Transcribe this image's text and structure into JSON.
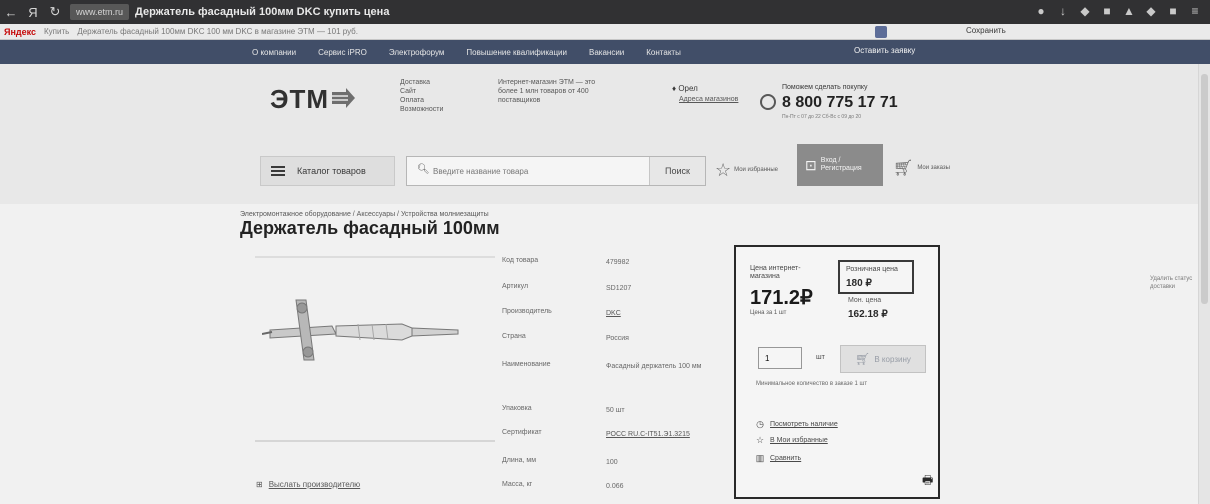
{
  "browser": {
    "nav": [
      "←",
      "Я",
      "↻"
    ],
    "site_chip": "www.etm.ru",
    "tab_title": "Держатель фасадный 100мм DKC купить цена",
    "tray_icons": [
      "user-icon",
      "download-icon",
      "extension-icon",
      "extension-icon",
      "extension-icon",
      "extension-icon",
      "extension-icon",
      "menu-icon"
    ]
  },
  "bookmarks": {
    "yandex": "Яндекс",
    "url_text": "Купить",
    "text": "Держатель фасадный 100мм DKC 100 мм DKC в магазине ЭТМ — 101 руб.",
    "button": "",
    "right1": "Сохранить",
    "right2": ""
  },
  "site_nav": {
    "links": [
      "О компании",
      "Сервис iPRO",
      "Электрофорум",
      "Повышение квалификации",
      "Вакансии",
      "Контакты"
    ],
    "review": "Оставить заявку"
  },
  "header": {
    "logo": "ЭТМ",
    "links": [
      "Доставка",
      "Сайт",
      "Оплата",
      "Возможности"
    ],
    "desc": "Интернет-магазин ЭТМ — это более 1 млн товаров от 400 поставщиков",
    "city": "Орел",
    "address_link": "Адреса магазинов",
    "phone_note": "Поможем сделать покупку",
    "phone": "8 800 775 17 71",
    "hours": "Пн-Пт с 07 до 22 Сб-Вс с 09 до 20"
  },
  "toolbar": {
    "catalog": "Каталог товаров",
    "search_placeholder": "Введите название товара",
    "search_btn": "Поиск",
    "fav_label": "Мои избранные",
    "login_label": "Вход / Регистрация",
    "orders_label": "Мои заказы"
  },
  "breadcrumb": "Электромонтажное оборудование / Аксессуары / Устройства молниезащиты",
  "product": {
    "title": "Держатель фасадный 100мм",
    "specs": [
      {
        "k": "Код товара",
        "v": "479982"
      },
      {
        "k": "Артикул",
        "v": "SD1207"
      },
      {
        "k": "Производитель",
        "v": "DKC"
      },
      {
        "k": "Страна",
        "v": "Россия"
      },
      {
        "k": "Наименование",
        "v": "Фасадный держатель 100 мм"
      },
      {
        "k": "Упаковка",
        "v": "50 шт"
      },
      {
        "k": "Сертификат",
        "v": "РОСС RU.C-IT51.Э1.3215"
      },
      {
        "k": "Длина, мм",
        "v": "100"
      },
      {
        "k": "Масса, кг",
        "v": "0.066"
      }
    ],
    "share": "Выслать производителю"
  },
  "price": {
    "label": "Цена интернет-магазина",
    "value": "171.2₽",
    "unit": "Цена за 1 шт",
    "retail_label": "Розничная цена",
    "retail_value": "180 ₽",
    "mon_label": "Мон. цена",
    "mon_value": "162.18 ₽",
    "qty": "1",
    "qty_unit": "шт",
    "cart_btn": "В корзину",
    "min_note": "Минимальное количество в заказе 1 шт",
    "actions": [
      "Посмотреть наличие",
      "В Мои избранные",
      "Сравнить"
    ]
  },
  "side_note": "Удалить статус доставки"
}
